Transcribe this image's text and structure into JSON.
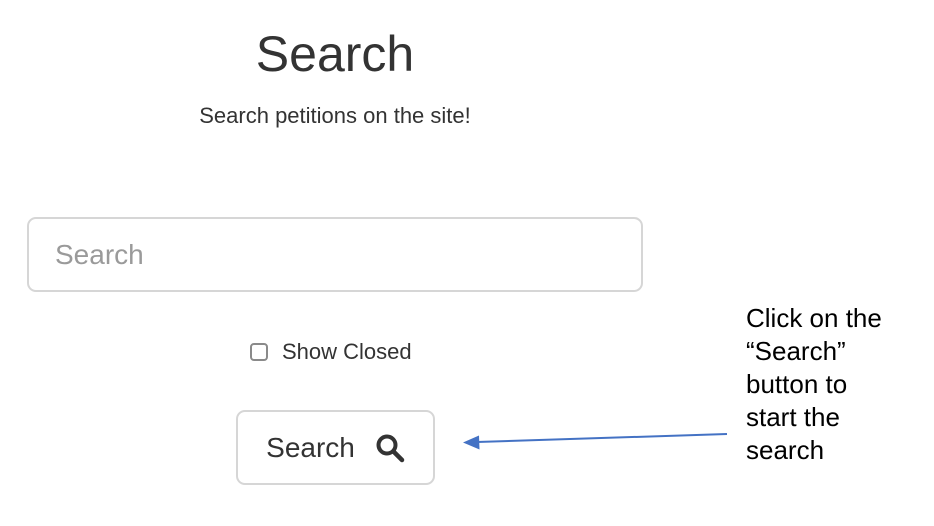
{
  "header": {
    "title": "Search",
    "subtitle": "Search petitions on the site!"
  },
  "search": {
    "placeholder": "Search",
    "value": ""
  },
  "filters": {
    "show_closed_label": "Show Closed",
    "show_closed_checked": false
  },
  "actions": {
    "search_button_label": "Search",
    "search_button_icon": "search-icon"
  },
  "annotation": {
    "text": "Click on the\n“Search”\nbutton to\nstart the\nsearch",
    "arrow_color": "#4472c4"
  },
  "colors": {
    "text": "#333333",
    "border": "#d6d6d6",
    "placeholder": "#9a9a9a"
  }
}
